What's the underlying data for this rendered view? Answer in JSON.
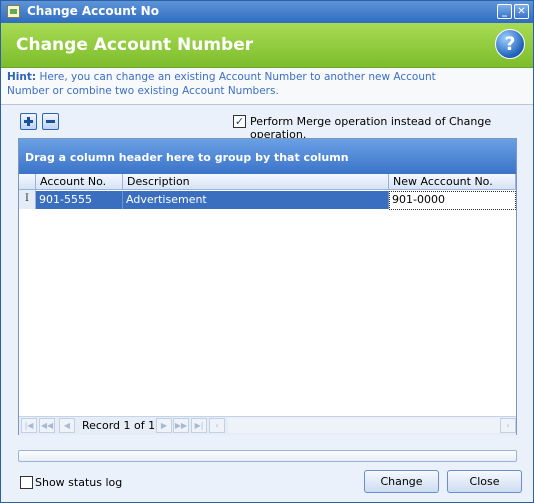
{
  "window": {
    "title": "Change Account No",
    "minimize_icon": "minimize-icon",
    "close_icon": "close-icon"
  },
  "header": {
    "title": "Change Account Number",
    "help_icon": "help-icon"
  },
  "hint": {
    "label": "Hint:",
    "text": "Here, you can change an existing Account Number to another new Account Number or combine two existing Account Numbers."
  },
  "toolbar": {
    "add_icon": "plus-icon",
    "remove_icon": "minus-icon"
  },
  "merge_option": {
    "checked": true,
    "label": "Perform Merge operation instead of Change operation."
  },
  "grid": {
    "group_panel_text": "Drag a column header here to group by that column",
    "columns": [
      "Account No.",
      "Description",
      "New Acccount No."
    ],
    "rows": [
      {
        "indicator": "I",
        "account_no": "901-5555",
        "description": "Advertisement",
        "new_account_no": "901-0000"
      }
    ],
    "navigator": {
      "record_text": "Record 1 of 1"
    }
  },
  "status_log": {
    "checked": false,
    "label": "Show status log"
  },
  "buttons": {
    "change": "Change",
    "close": "Close"
  },
  "colors": {
    "title_bar": "#2f6bc0",
    "header_green": "#8cc63e",
    "selected_row": "#3a6fc0",
    "group_panel": "#4d86d4"
  }
}
